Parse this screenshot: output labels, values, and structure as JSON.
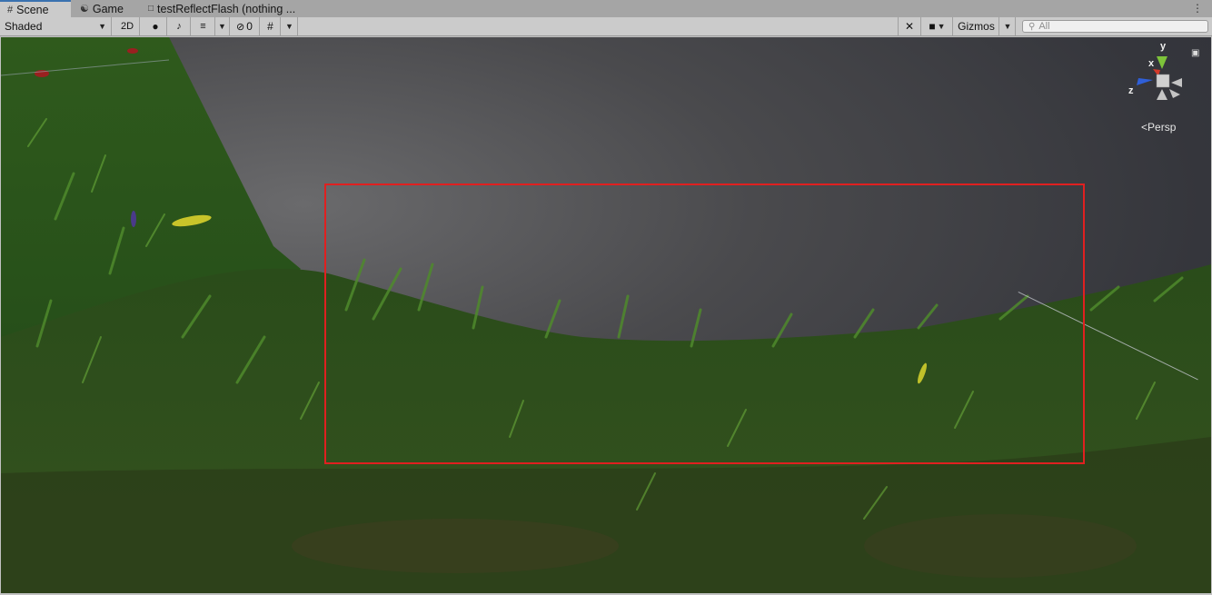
{
  "tabs": [
    {
      "label": "Scene",
      "icon": "grid-icon"
    },
    {
      "label": "Game",
      "icon": "gamepad-icon"
    },
    {
      "label": "testReflectFlash (nothing ...",
      "icon": "script-icon"
    }
  ],
  "toolbar": {
    "shading_mode": "Shaded",
    "mode_2d": "2D",
    "hidden_count": "0",
    "gizmos_label": "Gizmos",
    "search_placeholder": "All"
  },
  "scene_gizmo": {
    "axis_y": "y",
    "axis_x": "x",
    "axis_z": "z",
    "projection": "Persp"
  },
  "colors": {
    "selection_rect": "#e02020",
    "accent_tab": "#3a72b0"
  }
}
